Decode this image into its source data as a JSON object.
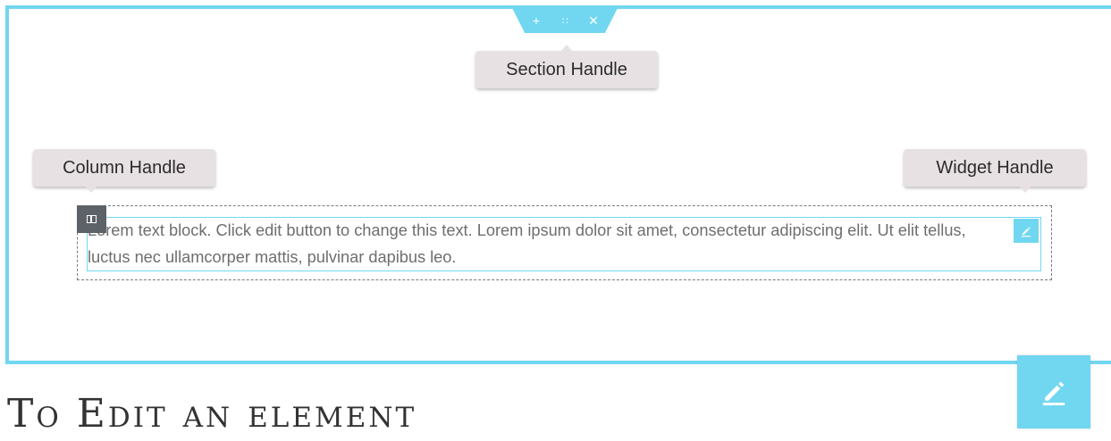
{
  "section": {
    "handle": {
      "add_icon": "plus-icon",
      "add_glyph": "+",
      "drag_icon": "drag-grip-icon",
      "drag_glyph": "∷",
      "close_icon": "close-icon",
      "close_glyph": "✕"
    }
  },
  "callouts": {
    "section": "Section Handle",
    "column": "Column Handle",
    "widget": "Widget Handle"
  },
  "widget": {
    "text": "Lorem text block. Click edit button to change this text. Lorem ipsum dolor sit amet, consectetur adipiscing elit. Ut elit tellus, luctus nec ullamcorper mattis, pulvinar dapibus leo.",
    "edit_icon": "pencil-icon"
  },
  "column": {
    "icon": "column-layout-icon"
  },
  "heading": "To Edit an element",
  "colors": {
    "accent": "#71d7f0",
    "column_handle": "#5d6268",
    "tooltip_bg": "#e8e1e3",
    "body_text": "#6e6e6e"
  }
}
